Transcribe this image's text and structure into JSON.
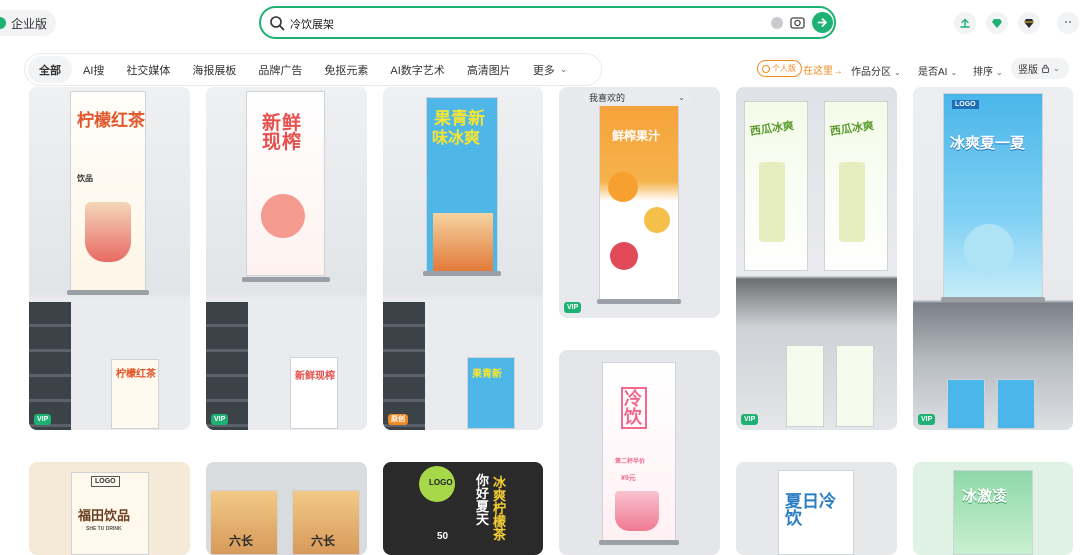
{
  "header": {
    "enterprise_label": "企业版",
    "search_value": "冷饮展架",
    "icons": [
      "upload-icon",
      "diamond-icon",
      "vip-gem-icon",
      "more-icon"
    ]
  },
  "tabs": [
    {
      "label": "全部",
      "active": true
    },
    {
      "label": "AI搜"
    },
    {
      "label": "社交媒体"
    },
    {
      "label": "海报展板"
    },
    {
      "label": "品牌广告"
    },
    {
      "label": "免抠元素"
    },
    {
      "label": "AI数字艺术"
    },
    {
      "label": "高清图片"
    },
    {
      "label": "更多"
    }
  ],
  "filters": {
    "personal_badge": "个人版",
    "here_link": "在这里→",
    "category": "作品分区",
    "ai": "是否AI",
    "sort": "排序",
    "edition": "竖版"
  },
  "favorite_pill": "我喜欢的",
  "badges": {
    "vip": "VIP",
    "orig": "原创"
  },
  "posters": {
    "p1": "柠檬红茶",
    "p1_sub": "饮品",
    "p2": "新鲜现榨",
    "p3": "果青新",
    "p3b": "味冰爽",
    "p4": "鲜榨果汁",
    "p5": "西瓜冰爽",
    "p6": "冰爽夏一夏",
    "p6_logo": "LOGO",
    "p7": "冷饮",
    "p7_sub": "第二杯半价",
    "p7_price": "¥9元",
    "p8_logo": "LOGO",
    "p8": "福田饮品",
    "p8_sub": "SHE TU DRINK",
    "p9": "六长",
    "p10_logo": "LOGO",
    "p10": "冰爽柠檬茶",
    "p10_side": "你好夏天",
    "p10_price": "50",
    "p11": "夏日冷饮",
    "p12": "冰激凌"
  }
}
